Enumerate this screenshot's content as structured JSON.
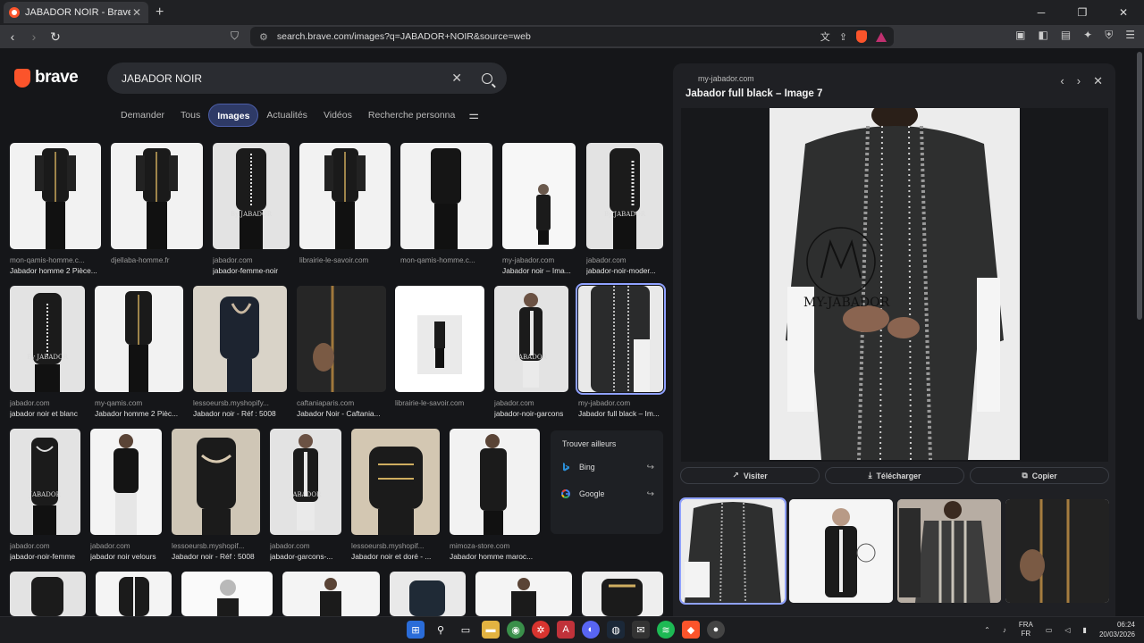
{
  "browser": {
    "tab_title": "JABADOR NOIR - Brave Search",
    "url": "search.brave.com/images?q=JABADOR+NOIR&source=web"
  },
  "brand": {
    "name": "brave",
    "accent": "#fb542b"
  },
  "search": {
    "query": "JABADOR NOIR"
  },
  "filters": [
    "Demander",
    "Tous",
    "Images",
    "Actualités",
    "Vidéos",
    "Recherche personna"
  ],
  "results": [
    {
      "src": "mon-qamis-homme.c...",
      "title": "Jabador homme 2 Pièce..."
    },
    {
      "src": "djellaba-homme.fr",
      "title": ""
    },
    {
      "src": "jabador.com",
      "title": "jabador-femme-noir"
    },
    {
      "src": "librairie-le-savoir.com",
      "title": ""
    },
    {
      "src": "mon-qamis-homme.c...",
      "title": ""
    },
    {
      "src": "my-jabador.com",
      "title": "Jabador noir – Ima..."
    },
    {
      "src": "jabador.com",
      "title": "jabador-noir-moder..."
    },
    {
      "src": "jabador.com",
      "title": "jabador noir et blanc"
    },
    {
      "src": "my-qamis.com",
      "title": "Jabador homme 2 Pièc..."
    },
    {
      "src": "lessoeursb.myshopify...",
      "title": "Jabador noir - Réf : 5008"
    },
    {
      "src": "caftaniaparis.com",
      "title": "Jabador Noir - Caftania..."
    },
    {
      "src": "librairie-le-savoir.com",
      "title": ""
    },
    {
      "src": "jabador.com",
      "title": "jabador-noir-garcons"
    },
    {
      "src": "my-jabador.com",
      "title": "Jabador full black – Im..."
    },
    {
      "src": "jabador.com",
      "title": "jabador-noir-femme"
    },
    {
      "src": "jabador.com",
      "title": "jabador noir velours"
    },
    {
      "src": "lessoeursb.myshopif...",
      "title": "Jabador noir - Réf : 5008"
    },
    {
      "src": "jabador.com",
      "title": "jabador-garcons-..."
    },
    {
      "src": "lessoeursb.myshopif...",
      "title": "Jabador noir et doré - ..."
    },
    {
      "src": "mimoza-store.com",
      "title": "Jabador homme maroc..."
    }
  ],
  "watermarks": {
    "by_jabador": "By JABADOR",
    "jabador": "JABADOR",
    "my_jabador": "MY-JABADOR"
  },
  "elsewhere": {
    "heading": "Trouver ailleurs",
    "bing": "Bing",
    "google": "Google"
  },
  "panel": {
    "site": "my-jabador.com",
    "title": "Jabador full black – Image 7",
    "visit": "Visiter",
    "download": "Télécharger",
    "copy": "Copier"
  },
  "taskbar": {
    "lang1": "FRA",
    "lang2": "FR",
    "time": "06:24",
    "date": "20/03/2026"
  }
}
